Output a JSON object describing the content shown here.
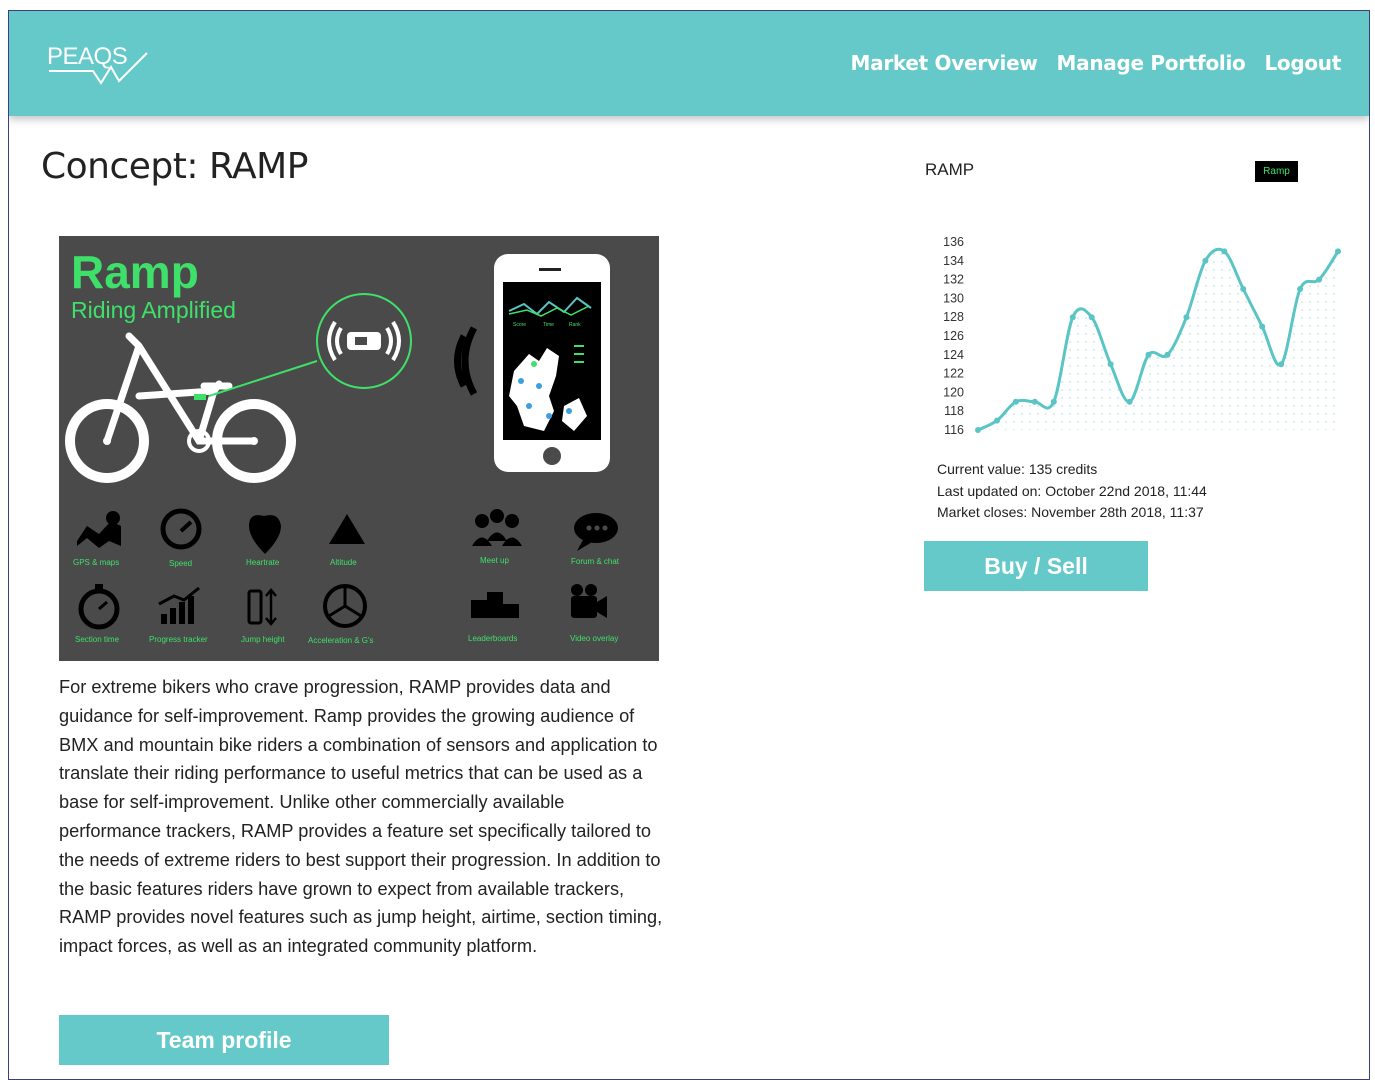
{
  "header": {
    "logo_text": "PEAQS",
    "nav": [
      "Market Overview",
      "Manage Portfolio",
      "Logout"
    ]
  },
  "page": {
    "title": "Concept: RAMP"
  },
  "concept_image": {
    "brand": "Ramp",
    "tagline": "Riding Amplified",
    "phone_labels": [
      "Score",
      "Time",
      "Rank"
    ],
    "features": [
      "GPS & maps",
      "Speed",
      "Heartrate",
      "Altitude",
      "Meet up",
      "Forum & chat",
      "Section time",
      "Progress tracker",
      "Jump height",
      "Acceleration & G's",
      "Leaderboards",
      "Video overlay"
    ],
    "accent_color": "#3fe06a",
    "background_color": "#4a4a4a"
  },
  "description": "For extreme bikers who crave progression, RAMP provides data and guidance for self-improvement. Ramp provides the growing audience of BMX and mountain bike riders a combination of sensors and application to translate their riding performance to useful metrics that can be used as a base for self-improvement. Unlike other commercially available performance trackers, RAMP provides a feature set specifically tailored to the needs of extreme riders to best support their progression. In addition to the basic features riders have grown to expect from available trackers, RAMP provides novel features such as jump height, airtime, section timing, impact forces, as well as an integrated community platform.",
  "buttons": {
    "team_profile": "Team profile",
    "buy_sell": "Buy / Sell"
  },
  "market": {
    "current_value": "Current value: 135 credits",
    "last_updated": "Last updated on: October 22nd 2018, 11:44",
    "market_closes": "Market closes: November 28th 2018, 11:37"
  },
  "colors": {
    "primary": "#66c9c9",
    "line": "#5bc4c4"
  },
  "chart_data": {
    "type": "line",
    "title": "RAMP",
    "legend": [
      "Ramp"
    ],
    "legend_color": "#000000",
    "y_ticks": [
      116,
      118,
      120,
      122,
      124,
      126,
      128,
      130,
      132,
      134,
      136
    ],
    "ylim": [
      116,
      136
    ],
    "series": [
      {
        "name": "Ramp",
        "values": [
          116,
          117,
          119,
          119,
          119,
          128,
          128,
          123,
          119,
          124,
          124,
          128,
          134,
          135,
          131,
          127,
          123,
          131,
          132,
          135
        ]
      }
    ]
  }
}
